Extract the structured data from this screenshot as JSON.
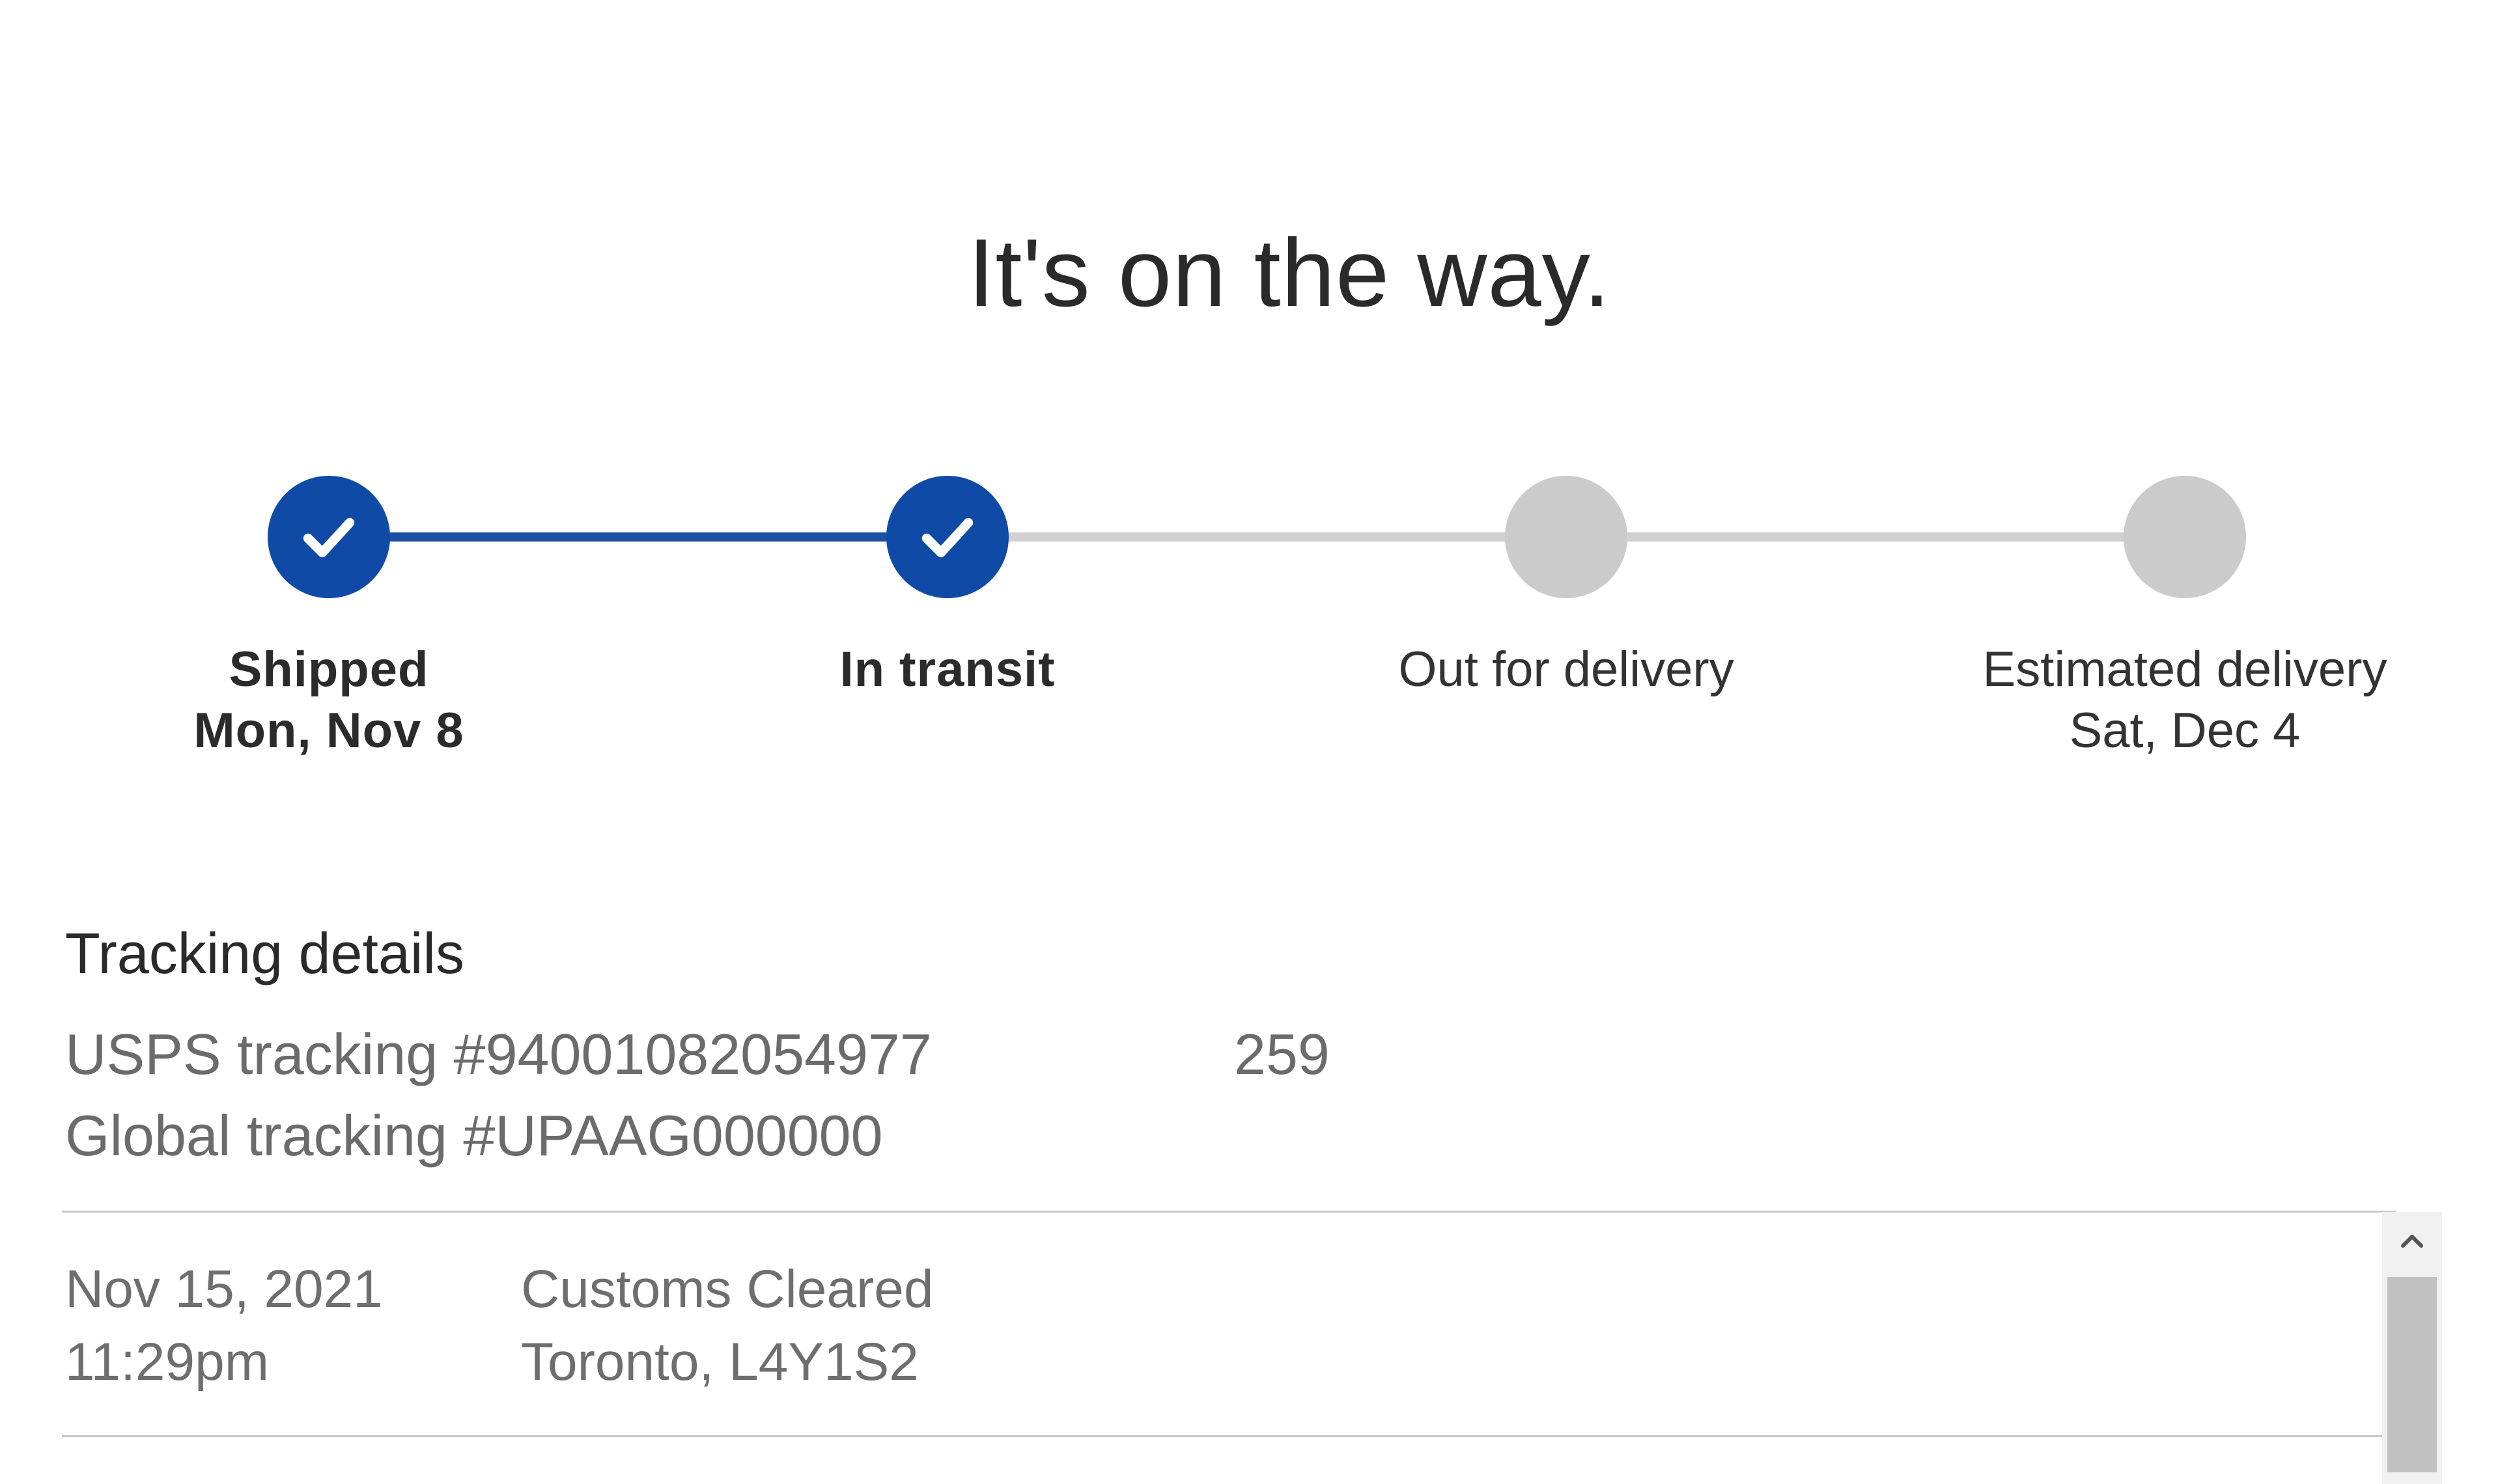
{
  "headline": "It's on the way.",
  "progress": {
    "steps": [
      {
        "label": "Shipped",
        "date": "Mon, Nov 8",
        "status": "completed",
        "icon": "check-icon"
      },
      {
        "label": "In transit",
        "date": "",
        "status": "completed",
        "icon": "check-icon"
      },
      {
        "label": "Out for delivery",
        "date": "",
        "status": "pending",
        "icon": ""
      },
      {
        "label": "Estimated delivery",
        "date": "Sat, Dec 4",
        "status": "pending",
        "icon": ""
      }
    ],
    "completed_color": "#0f4aa6",
    "pending_color": "#cbcbcb"
  },
  "tracking": {
    "title": "Tracking details",
    "usps": "USPS tracking #94001082054977",
    "usps_suffix": "259",
    "global": "Global tracking #UPAAG000000"
  },
  "events": [
    {
      "date": "Nov 15, 2021",
      "time": "11:29pm",
      "status": "Customs Cleared",
      "location": "Toronto, L4Y1S2"
    }
  ],
  "scrollbar": {
    "up_icon": "chevron-up-icon"
  }
}
